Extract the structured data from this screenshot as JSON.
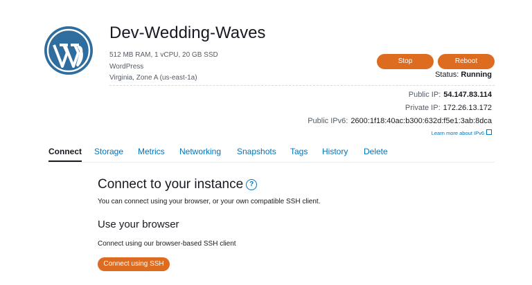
{
  "instance": {
    "name": "Dev-Wedding-Waves",
    "specs": "512 MB RAM, 1 vCPU, 20 GB SSD",
    "blueprint": "WordPress",
    "location": "Virginia, Zone A (us-east-1a)",
    "logo_icon": "wordpress-logo"
  },
  "actions": {
    "stop_label": "Stop",
    "reboot_label": "Reboot",
    "accent_color": "#dd6b20"
  },
  "status": {
    "label": "Status:",
    "value": "Running"
  },
  "network": {
    "public_ip_label": "Public IP:",
    "public_ip": "54.147.83.114",
    "private_ip_label": "Private IP:",
    "private_ip": "172.26.13.172",
    "public_ipv6_label": "Public IPv6:",
    "public_ipv6": "2600:1f18:40ac:b300:632d:f5e1:3ab:8dca",
    "learn_more": "Learn more about IPv6"
  },
  "tabs": [
    {
      "label": "Connect",
      "active": true
    },
    {
      "label": "Storage",
      "active": false
    },
    {
      "label": "Metrics",
      "active": false
    },
    {
      "label": "Networking",
      "active": false
    },
    {
      "label": "Snapshots",
      "active": false
    },
    {
      "label": "Tags",
      "active": false
    },
    {
      "label": "History",
      "active": false
    },
    {
      "label": "Delete",
      "active": false
    }
  ],
  "connect": {
    "title": "Connect to your instance",
    "help_icon": "?",
    "description": "You can connect using your browser, or your own compatible SSH client.",
    "browser_title": "Use your browser",
    "browser_description": "Connect using our browser-based SSH client",
    "ssh_button": "Connect using SSH"
  }
}
